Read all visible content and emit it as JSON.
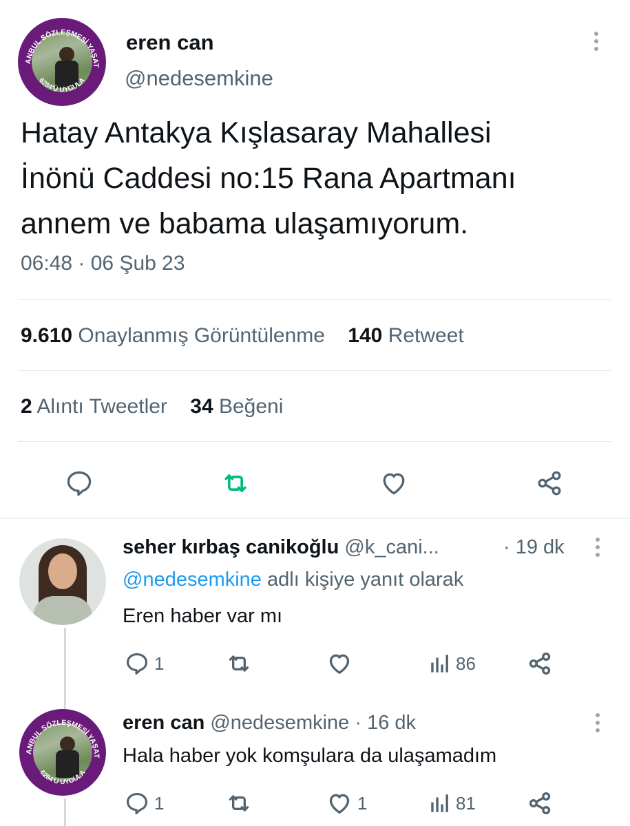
{
  "main_tweet": {
    "author_name": "eren can",
    "author_handle": "@nedesemkine",
    "avatar_ring_text_top": "İSTANBUL SÖZLEŞMESİ YAŞATIR",
    "avatar_ring_text_bottom": "6284'Ü UYGULA",
    "text_line1": "Hatay Antakya Kışlasaray Mahallesi",
    "text_line2": "İnönü Caddesi no:15 Rana Apartmanı",
    "text_line3": "annem ve babama ulaşamıyorum.",
    "timestamp": "06:48 · 06 Şub 23",
    "views_count": "9.610",
    "views_label": "Onaylanmış Görüntülenme",
    "retweets_count": "140",
    "retweets_label": "Retweet",
    "quotes_count": "2",
    "quotes_label": "Alıntı Tweetler",
    "likes_count": "34",
    "likes_label": "Beğeni"
  },
  "replies": [
    {
      "author_name": "seher kırbaş canikoğlu",
      "author_handle": "@k_cani...",
      "time": "· 19 dk",
      "reply_to_handle": "@nedesemkine",
      "reply_to_suffix": "adlı kişiye yanıt olarak",
      "text": "Eren haber var mı",
      "reply_count": "1",
      "retweet_count": "",
      "like_count": "",
      "view_count": "86"
    },
    {
      "author_name": "eren can",
      "author_handle": "@nedesemkine",
      "time": "· 16 dk",
      "text": "Hala haber yok komşulara da ulaşamadım",
      "reply_count": "1",
      "retweet_count": "",
      "like_count": "1",
      "view_count": "81"
    }
  ],
  "colors": {
    "accent_retweet": "#00ba7c",
    "link": "#1d9bf0",
    "secondary_text": "#536471",
    "ring": "#6a1b7a"
  },
  "icons": [
    "reply-icon",
    "retweet-icon",
    "like-icon",
    "share-icon",
    "views-icon",
    "more-icon"
  ]
}
